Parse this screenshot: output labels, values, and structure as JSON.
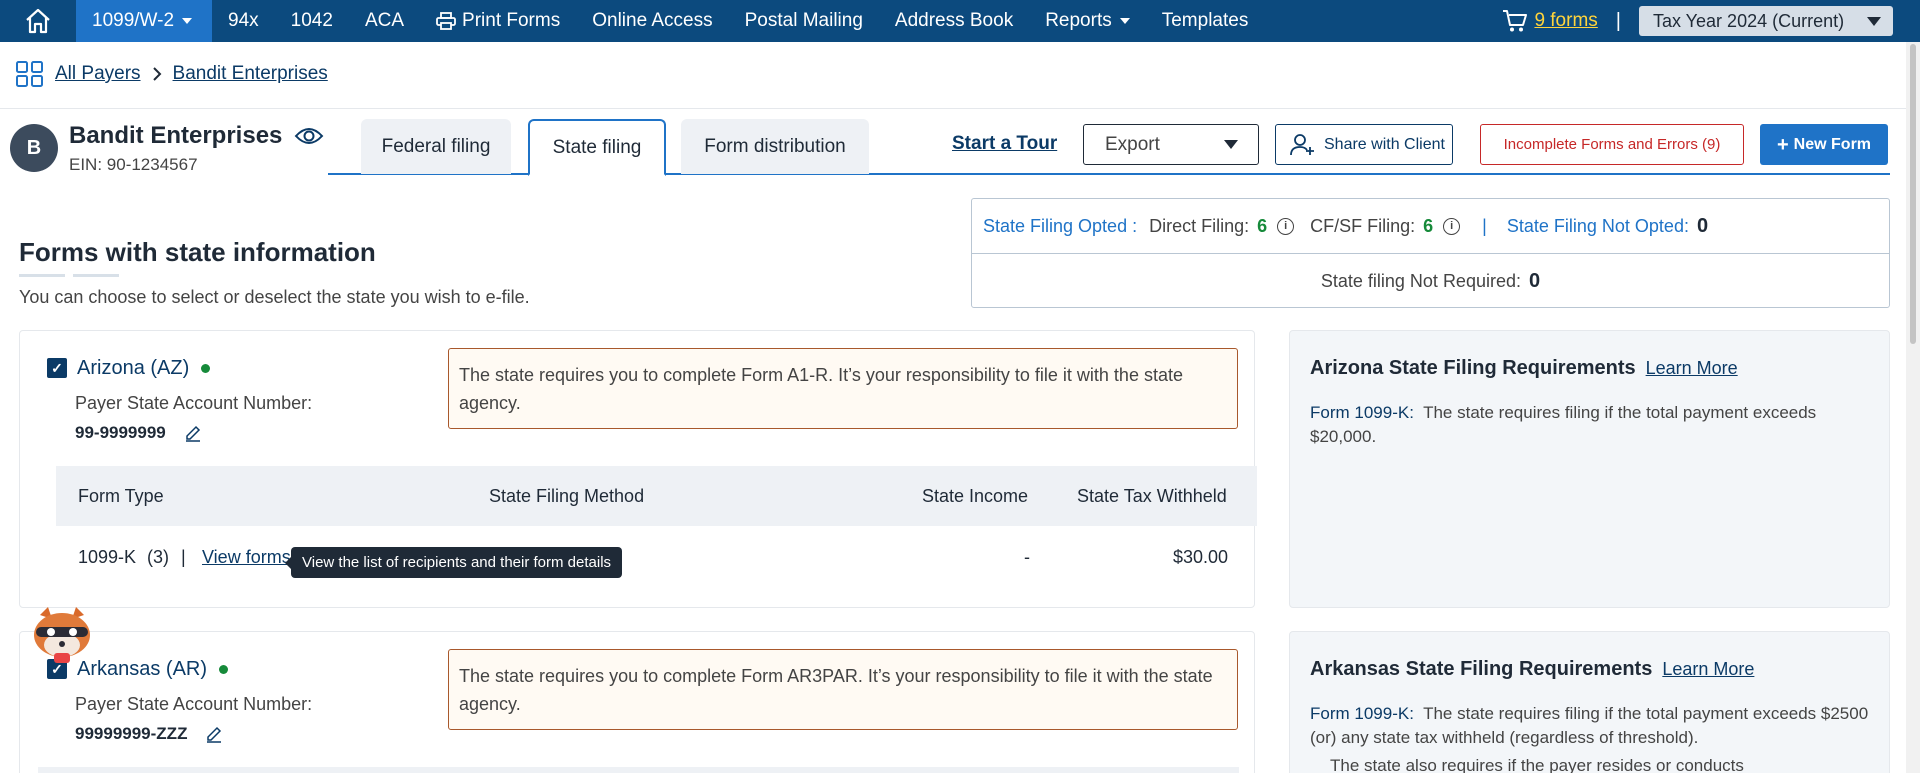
{
  "nav": {
    "items": [
      "1099/W-2",
      "94x",
      "1042",
      "ACA",
      "Print Forms",
      "Online Access",
      "Postal Mailing",
      "Address Book",
      "Reports",
      "Templates"
    ],
    "cart_label": "9 forms",
    "separator": "|",
    "tax_year": "Tax Year 2024 (Current)"
  },
  "breadcrumb": {
    "all_payers": "All Payers",
    "payer": "Bandit Enterprises"
  },
  "payer": {
    "initial": "B",
    "name": "Bandit Enterprises",
    "ein": "EIN: 90-1234567"
  },
  "tabs": [
    "Federal filing",
    "State filing",
    "Form distribution"
  ],
  "toolbar": {
    "tour": "Start a Tour",
    "export": "Export",
    "share": "Share with Client",
    "errors": "Incomplete Forms and Errors (9)",
    "new_form": "New Form"
  },
  "summary": {
    "opted_label": "State Filing Opted :",
    "direct_label": "Direct Filing:",
    "direct_count": "6",
    "cfsf_label": "CF/SF Filing:",
    "cfsf_count": "6",
    "divider": "|",
    "not_opted_label": "State Filing Not Opted:",
    "not_opted_count": "0",
    "not_required_label": "State filing Not Required:",
    "not_required_count": "0"
  },
  "section": {
    "title": "Forms with state information",
    "subtitle": "You can choose to select or deselect the state you wish to e-file."
  },
  "states": [
    {
      "name": "Arizona (AZ)",
      "psan_label": "Payer State Account Number:",
      "psan": "99-9999999",
      "notice": "The state requires you to complete Form A1-R. It’s your responsibility to file it with the state agency.",
      "table": {
        "headers": [
          "Form Type",
          "State Filing Method",
          "State Income",
          "State Tax Withheld"
        ],
        "row": {
          "form": "1099-K",
          "count": "(3)",
          "sep": "|",
          "view": "View forms",
          "income": "-",
          "withheld": "$30.00"
        }
      },
      "tooltip": "View the list of recipients and their form details",
      "req_title": "Arizona State Filing Requirements",
      "req_link": "Learn More",
      "req_form": "Form 1099-K:",
      "req_text": "The state requires filing if the total payment exceeds $20,000."
    },
    {
      "name": "Arkansas (AR)",
      "psan_label": "Payer State Account Number:",
      "psan": "99999999-ZZZ",
      "notice": "The state requires you to complete Form AR3PAR. It’s your responsibility to file it with the state agency.",
      "req_title": "Arkansas State Filing Requirements",
      "req_link": "Learn More",
      "req_form": "Form 1099-K:",
      "req_text": "The state requires filing if the total payment exceeds $2500 (or) any state tax withheld (regardless of threshold).",
      "req_text2": "The state also requires if the payer resides or conducts"
    }
  ],
  "icons": [
    "home-icon",
    "printer-icon",
    "cart-icon",
    "grid-icon",
    "chevron-right-icon",
    "eye-icon",
    "user-plus-icon",
    "plus-icon",
    "info-icon",
    "pencil-icon",
    "check-icon",
    "mascot-icon"
  ],
  "colors": {
    "nav_bg": "#0c4a7e",
    "nav_active": "#1f73c7",
    "accent": "#1f73c7",
    "error": "#c62828",
    "success": "#168a3a",
    "cart": "#ffd43b"
  }
}
